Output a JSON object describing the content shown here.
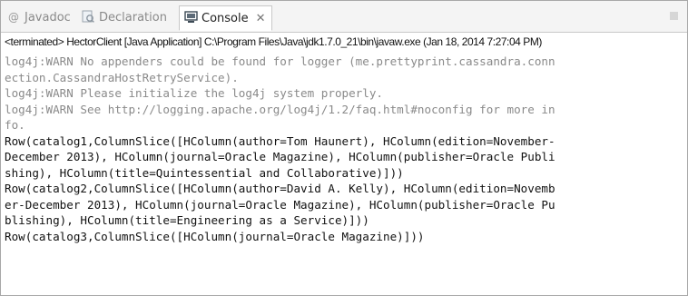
{
  "tabs": [
    {
      "label": "Javadoc",
      "icon": "at-sign-icon"
    },
    {
      "label": "Declaration",
      "icon": "declaration-icon"
    },
    {
      "label": "Console",
      "icon": "console-icon",
      "close": "✕"
    }
  ],
  "status_line": "<terminated> HectorClient [Java Application] C:\\Program Files\\Java\\jdk1.7.0_21\\bin\\javaw.exe (Jan 18, 2014 7:27:04 PM)",
  "console": {
    "lines": [
      {
        "text": "log4j:WARN No appenders could be found for logger (me.prettyprint.cassandra.conn",
        "kind": "warn"
      },
      {
        "text": "ection.CassandraHostRetryService).",
        "kind": "warn"
      },
      {
        "text": "log4j:WARN Please initialize the log4j system properly.",
        "kind": "warn"
      },
      {
        "text": "log4j:WARN See http://logging.apache.org/log4j/1.2/faq.html#noconfig for more in",
        "kind": "warn"
      },
      {
        "text": "fo.",
        "kind": "warn"
      },
      {
        "text": "Row(catalog1,ColumnSlice([HColumn(author=Tom Haunert), HColumn(edition=November-",
        "kind": "out"
      },
      {
        "text": "December 2013), HColumn(journal=Oracle Magazine), HColumn(publisher=Oracle Publi",
        "kind": "out"
      },
      {
        "text": "shing), HColumn(title=Quintessential and Collaborative)]))",
        "kind": "out"
      },
      {
        "text": "Row(catalog2,ColumnSlice([HColumn(author=David A. Kelly), HColumn(edition=Novemb",
        "kind": "out"
      },
      {
        "text": "er-December 2013), HColumn(journal=Oracle Magazine), HColumn(publisher=Oracle Pu",
        "kind": "out"
      },
      {
        "text": "blishing), HColumn(title=Engineering as a Service)]))",
        "kind": "out"
      },
      {
        "text": "Row(catalog3,ColumnSlice([HColumn(journal=Oracle Magazine)]))",
        "kind": "out"
      }
    ]
  },
  "colors": {
    "warn": "#8a8a8a",
    "out": "#111111",
    "tab_active_bg": "#ffffff"
  }
}
